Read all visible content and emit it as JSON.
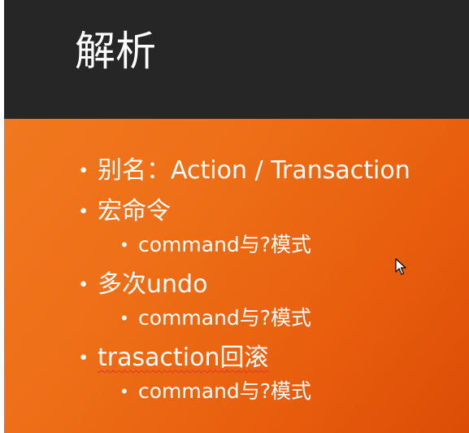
{
  "slide": {
    "title": "解析",
    "bullets": [
      {
        "level": 1,
        "text": "别名：Action / Transaction"
      },
      {
        "level": 1,
        "text": "宏命令"
      },
      {
        "level": 2,
        "text": "command与?模式"
      },
      {
        "level": 1,
        "text": "多次undo"
      },
      {
        "level": 2,
        "text": "command与?模式"
      },
      {
        "level": 1,
        "text": "trasaction回滚"
      },
      {
        "level": 2,
        "text": "command与?模式"
      }
    ]
  },
  "colors": {
    "header_background": "#262626",
    "body_gradient_start": "#f1781e",
    "body_gradient_end": "#dc4c06",
    "text": "#ffffff",
    "spellcheck_underline": "#e0332a"
  },
  "icons": {
    "bullet": "bullet-dot-icon",
    "pointer": "mouse-pointer-icon"
  }
}
